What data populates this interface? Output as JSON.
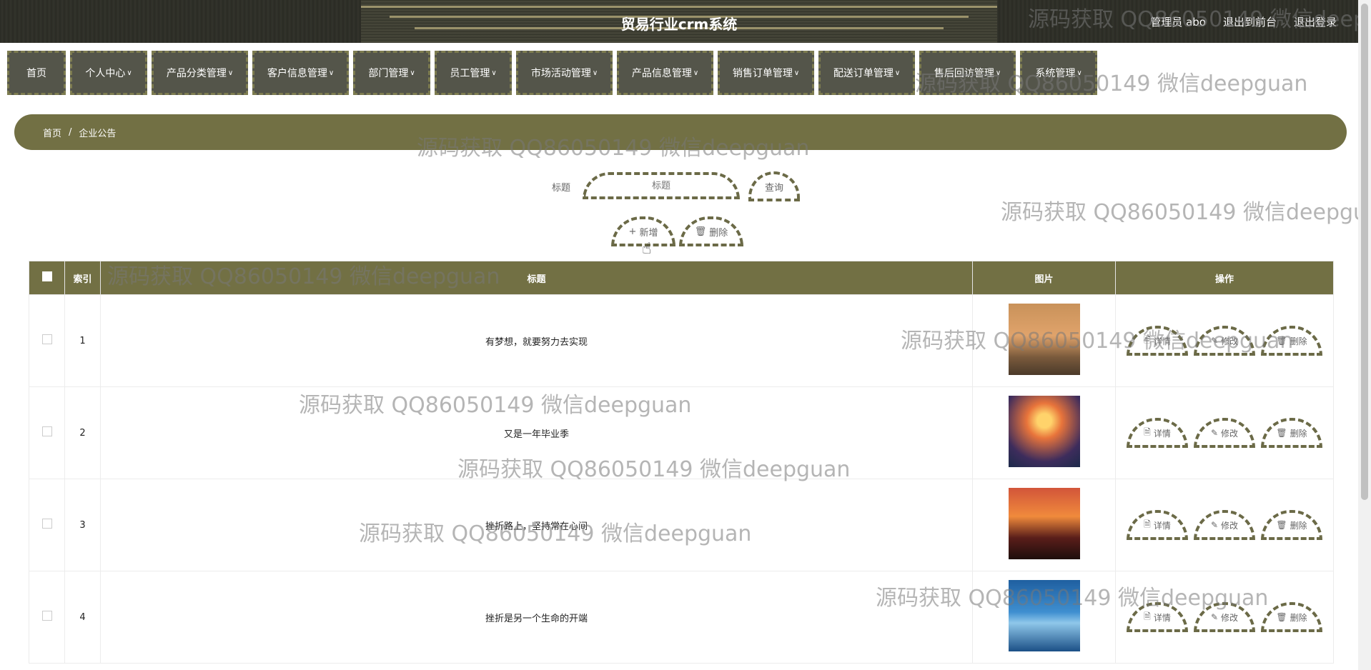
{
  "header": {
    "title": "贸易行业crm系统",
    "admin_label": "管理员 abo",
    "to_front": "退出到前台",
    "logout": "退出登录"
  },
  "nav": {
    "items": [
      {
        "label": "首页"
      },
      {
        "label": "个人中心"
      },
      {
        "label": "产品分类管理"
      },
      {
        "label": "客户信息管理"
      },
      {
        "label": "部门管理"
      },
      {
        "label": "员工管理"
      },
      {
        "label": "市场活动管理"
      },
      {
        "label": "产品信息管理"
      },
      {
        "label": "销售订单管理"
      },
      {
        "label": "配送订单管理"
      },
      {
        "label": "售后回访管理"
      },
      {
        "label": "系统管理"
      }
    ]
  },
  "breadcrumb": {
    "home": "首页",
    "sep": "/",
    "current": "企业公告"
  },
  "search": {
    "label": "标题",
    "placeholder": "标题",
    "query_button": "查询"
  },
  "actions": {
    "add": "新增",
    "delete": "删除"
  },
  "table": {
    "headers": {
      "index": "索引",
      "title": "标题",
      "image": "图片",
      "ops": "操作"
    },
    "rows": [
      {
        "index": "1",
        "title": "有梦想，就要努力去实现"
      },
      {
        "index": "2",
        "title": "又是一年毕业季"
      },
      {
        "index": "3",
        "title": "挫折路上，坚持常在心间"
      },
      {
        "index": "4",
        "title": "挫折是另一个生命的开端"
      }
    ],
    "ops": {
      "detail": "详情",
      "edit": "修改",
      "delete": "删除"
    }
  },
  "watermark": "源码获取 QQ86050149 微信deepguan",
  "colors": {
    "accent": "#727044",
    "nav_bg": "#54554a",
    "dash": "#6b6a47"
  }
}
